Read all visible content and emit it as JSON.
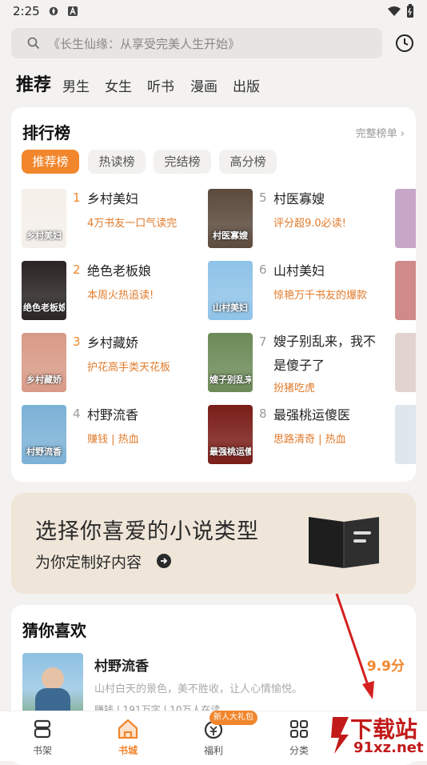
{
  "status": {
    "time": "2:25"
  },
  "search": {
    "placeholder": "《长生仙缘：从享受完美人生开始》"
  },
  "tabs": [
    {
      "label": "推荐",
      "active": true
    },
    {
      "label": "男生"
    },
    {
      "label": "女生"
    },
    {
      "label": "听书"
    },
    {
      "label": "漫画"
    },
    {
      "label": "出版"
    }
  ],
  "ranking": {
    "title": "排行榜",
    "more": "完整榜单",
    "chips": [
      {
        "label": "推荐榜",
        "active": true
      },
      {
        "label": "热读榜"
      },
      {
        "label": "完结榜"
      },
      {
        "label": "高分榜"
      }
    ],
    "items": [
      {
        "rank": "1",
        "name": "乡村美妇",
        "sub": "4万书友一口气读完",
        "cover_text": "乡村美妇",
        "cover_color": "#f4efe9",
        "rank_color": "#f1862d"
      },
      {
        "rank": "2",
        "name": "绝色老板娘",
        "sub": "本周火热追读!",
        "cover_text": "绝色老板娘",
        "cover_color": "#2a2424",
        "rank_color": "#f1862d"
      },
      {
        "rank": "3",
        "name": "乡村藏娇",
        "sub": "护花高手类天花板",
        "cover_text": "乡村藏娇",
        "cover_color": "#d89a86",
        "rank_color": "#f1862d"
      },
      {
        "rank": "4",
        "name": "村野流香",
        "sub": "赚钱 | 热血",
        "cover_text": "村野流香",
        "cover_color": "#7bb1d6",
        "rank_color": "#999999"
      },
      {
        "rank": "5",
        "name": "村医寡嫂",
        "sub": "评分超9.0必读!",
        "cover_text": "村医寡嫂",
        "cover_color": "#5b4a3c",
        "rank_color": "#999999"
      },
      {
        "rank": "6",
        "name": "山村美妇",
        "sub": "惊艳万千书友的爆款",
        "cover_text": "山村美妇",
        "cover_color": "#8fc3e8",
        "rank_color": "#999999"
      },
      {
        "rank": "7",
        "name": "嫂子别乱来，我不是傻子了",
        "sub": "扮猪吃虎",
        "cover_text": "嫂子别乱来",
        "cover_color": "#6b8a57",
        "rank_color": "#999999"
      },
      {
        "rank": "8",
        "name": "最强桃运傻医",
        "sub": "思路清奇 | 热血",
        "cover_text": "最强桃运傻医",
        "cover_color": "#7a1d18",
        "rank_color": "#999999"
      }
    ],
    "peek_covers": [
      "#c7a7c8",
      "#d08a8a",
      "#e3d3cf",
      "#dfe6ee"
    ]
  },
  "banner": {
    "title": "选择你喜爱的小说类型",
    "subtitle": "为你定制好内容"
  },
  "guess": {
    "title": "猜你喜欢",
    "book": {
      "name": "村野流香",
      "score": "9.9分",
      "desc": "山村白天的景色，美不胜收，让人心情愉悦。",
      "meta": "赚钱 | 191万字 | 10万人在读"
    }
  },
  "tabbar": [
    {
      "label": "书架",
      "icon": "bookshelf-icon"
    },
    {
      "label": "书城",
      "icon": "home-icon",
      "active": true
    },
    {
      "label": "福利",
      "icon": "coin-icon",
      "badge": "新人大礼包"
    },
    {
      "label": "分类",
      "icon": "category-grid-icon"
    }
  ],
  "watermark": {
    "line1": "下载站",
    "line2": "91xz.net"
  },
  "colors": {
    "accent": "#f1862d",
    "annotation_arrow": "#d42020"
  }
}
